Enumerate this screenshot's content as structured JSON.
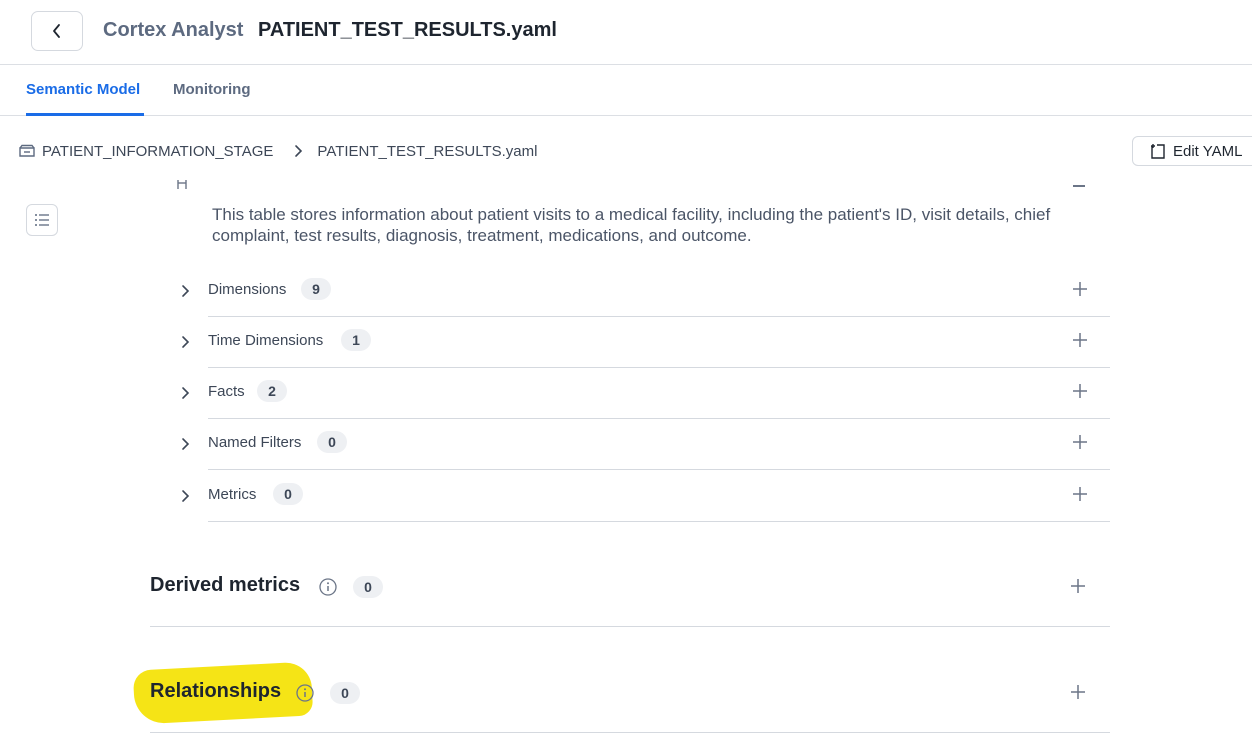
{
  "header": {
    "app_name": "Cortex Analyst",
    "file_name": "PATIENT_TEST_RESULTS.yaml"
  },
  "tabs": [
    {
      "label": "Semantic Model",
      "active": true
    },
    {
      "label": "Monitoring",
      "active": false
    }
  ],
  "breadcrumb": {
    "stage": "PATIENT_INFORMATION_STAGE",
    "file": "PATIENT_TEST_RESULTS.yaml"
  },
  "toolbar": {
    "edit_yaml_label": "Edit YAML"
  },
  "table": {
    "description": "This table stores information about patient visits to a medical facility, including the patient's ID, visit details, chief complaint, test results, diagnosis, treatment, medications, and outcome.",
    "groups": [
      {
        "label": "Dimensions",
        "count": "9"
      },
      {
        "label": "Time Dimensions",
        "count": "1"
      },
      {
        "label": "Facts",
        "count": "2"
      },
      {
        "label": "Named Filters",
        "count": "0"
      },
      {
        "label": "Metrics",
        "count": "0"
      }
    ]
  },
  "sections": {
    "derived_metrics": {
      "title": "Derived metrics",
      "count": "0"
    },
    "relationships": {
      "title": "Relationships",
      "count": "0",
      "highlighted": true
    }
  },
  "colors": {
    "accent": "#1a6ce7",
    "highlight": "#f4e30a"
  }
}
